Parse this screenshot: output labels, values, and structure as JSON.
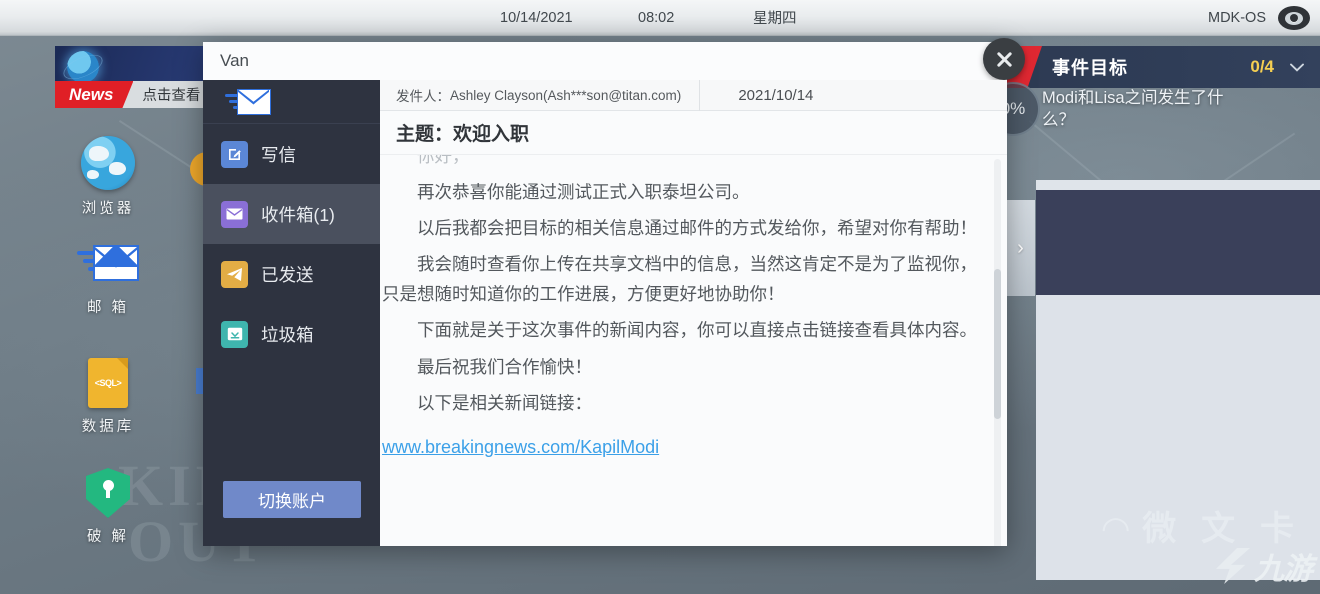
{
  "topbar": {
    "date": "10/14/2021",
    "time": "08:02",
    "weekday": "星期四",
    "os_name": "MDK-OS",
    "eye_icon": "eye-icon"
  },
  "news_banner": {
    "tag": "News",
    "text": "点击查看",
    "globe_icon": "globe-icon"
  },
  "desktop_icons": [
    {
      "label": "浏览器",
      "icon": "globe-icon"
    },
    {
      "label": "邮 箱",
      "icon": "mail-icon"
    },
    {
      "label": "数据库",
      "icon": "database-sql-icon",
      "glyph": "<SQL>"
    },
    {
      "label": "破 解",
      "icon": "shield-key-icon"
    }
  ],
  "wallpaper_text": [
    "KINGDO",
    "OUT"
  ],
  "objective_panel": {
    "title": "事件目标",
    "count": "0/4",
    "star_icon": "star-icon",
    "chevron_icon": "chevron-down-icon",
    "objective_text": "Modi和Lisa之间发生了什么？",
    "reason_link": "推理›",
    "progress_badge": "0%"
  },
  "mail_window": {
    "title": "Van",
    "close_icon": "close-icon",
    "logo_icon": "mail-logo-icon",
    "sidebar": [
      {
        "label": "写信",
        "icon": "compose-icon",
        "active": false
      },
      {
        "label": "收件箱(1)",
        "icon": "inbox-icon",
        "active": true
      },
      {
        "label": "已发送",
        "icon": "sent-icon",
        "active": false
      },
      {
        "label": "垃圾箱",
        "icon": "trash-icon",
        "active": false
      }
    ],
    "switch_account_label": "切换账户",
    "message": {
      "from_label": "发件人：",
      "from_value": "Ashley Clayson(Ash***son@titan.com)",
      "date": "2021/10/14",
      "subject": "主题：欢迎入职",
      "clipped_line": "你好，",
      "paragraphs": [
        "再次恭喜你能通过测试正式入职泰坦公司。",
        "以后我都会把目标的相关信息通过邮件的方式发给你，希望对你有帮助！",
        "我会随时查看你上传在共享文档中的信息，当然这肯定不是为了监视你，只是想随时知道你的工作进展，方便更好地协助你！",
        "下面就是关于这次事件的新闻内容，你可以直接点击链接查看具体内容。",
        "最后祝我们合作愉快！",
        "以下是相关新闻链接："
      ],
      "link": "www.breakingnews.com/KapilModi"
    }
  },
  "watermark": {
    "brand": "九游",
    "logo_icon": "jiuyou-logo-icon"
  },
  "colors": {
    "accent_red": "#e02832",
    "link_blue": "#3ba0e8",
    "sidebar_dark": "#2e3340",
    "button_blue": "#7089c9",
    "count_yellow": "#f5cf52"
  }
}
